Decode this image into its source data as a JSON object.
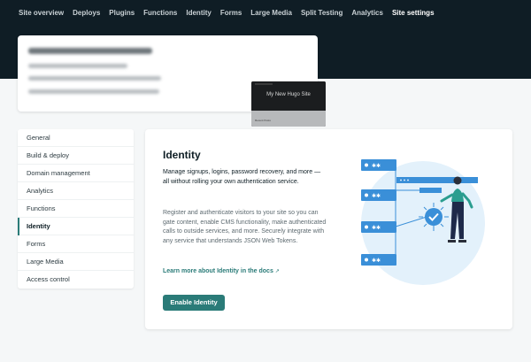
{
  "topnav": {
    "items": [
      {
        "label": "Site overview"
      },
      {
        "label": "Deploys"
      },
      {
        "label": "Plugins"
      },
      {
        "label": "Functions"
      },
      {
        "label": "Identity"
      },
      {
        "label": "Forms"
      },
      {
        "label": "Large Media"
      },
      {
        "label": "Split Testing"
      },
      {
        "label": "Analytics"
      },
      {
        "label": "Site settings",
        "active": true
      }
    ]
  },
  "site_card": {
    "thumbnail_title": "My New Hugo Site",
    "thumbnail_caption": "Recent Posts"
  },
  "sidenav": {
    "items": [
      {
        "label": "General"
      },
      {
        "label": "Build & deploy"
      },
      {
        "label": "Domain management"
      },
      {
        "label": "Analytics"
      },
      {
        "label": "Functions"
      },
      {
        "label": "Identity",
        "active": true
      },
      {
        "label": "Forms"
      },
      {
        "label": "Large Media"
      },
      {
        "label": "Access control"
      }
    ]
  },
  "identity": {
    "title": "Identity",
    "lead": "Manage signups, logins, password recovery, and more — all without rolling your own authentication service.",
    "body": "Register and authenticate visitors to your site so you can gate content, enable CMS functionality, make authenticated calls to outside services, and more. Securely integrate with any service that understands JSON Web Tokens.",
    "docs_link": "Learn more about Identity in the docs",
    "docs_link_arrow": "↗",
    "enable_button": "Enable Identity"
  },
  "colors": {
    "header_bg": "#0f1d25",
    "accent": "#2a7b78",
    "illustration_blue": "#3a8fd8",
    "illustration_circle": "#e3f1fb"
  },
  "icons": [
    "user-icon",
    "asterisk-icon",
    "check-icon",
    "external-link-icon"
  ]
}
